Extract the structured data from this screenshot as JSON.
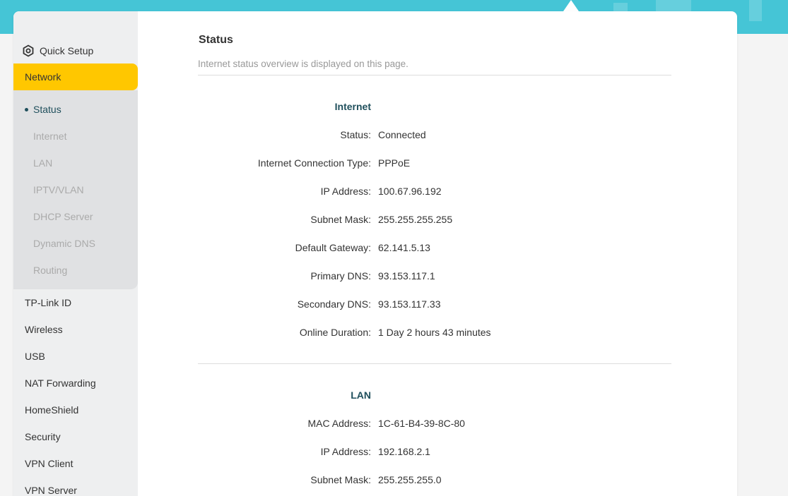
{
  "sidebar": {
    "quick_setup": "Quick Setup",
    "network": "Network",
    "network_sub": [
      "Status",
      "Internet",
      "LAN",
      "IPTV/VLAN",
      "DHCP Server",
      "Dynamic DNS",
      "Routing"
    ],
    "items": [
      "TP-Link ID",
      "Wireless",
      "USB",
      "NAT Forwarding",
      "HomeShield",
      "Security",
      "VPN Client",
      "VPN Server"
    ]
  },
  "main": {
    "title": "Status",
    "description": "Internet status overview is displayed on this page.",
    "internet": {
      "heading": "Internet",
      "rows": [
        {
          "label": "Status:",
          "value": "Connected"
        },
        {
          "label": "Internet Connection Type:",
          "value": "PPPoE"
        },
        {
          "label": "IP Address:",
          "value": "100.67.96.192"
        },
        {
          "label": "Subnet Mask:",
          "value": "255.255.255.255"
        },
        {
          "label": "Default Gateway:",
          "value": "62.141.5.13"
        },
        {
          "label": "Primary DNS:",
          "value": "93.153.117.1"
        },
        {
          "label": "Secondary DNS:",
          "value": "93.153.117.33"
        },
        {
          "label": "Online Duration:",
          "value": "1 Day 2 hours 43 minutes"
        }
      ]
    },
    "lan": {
      "heading": "LAN",
      "rows": [
        {
          "label": "MAC Address:",
          "value": "1C-61-B4-39-8C-80"
        },
        {
          "label": "IP Address:",
          "value": "192.168.2.1"
        },
        {
          "label": "Subnet Mask:",
          "value": "255.255.255.0"
        }
      ]
    }
  },
  "colors": {
    "banner": "#45c5d6",
    "active_menu": "#ffc700",
    "heading": "#1f4f5c"
  },
  "icons": {
    "quick_setup": "gear-icon"
  }
}
